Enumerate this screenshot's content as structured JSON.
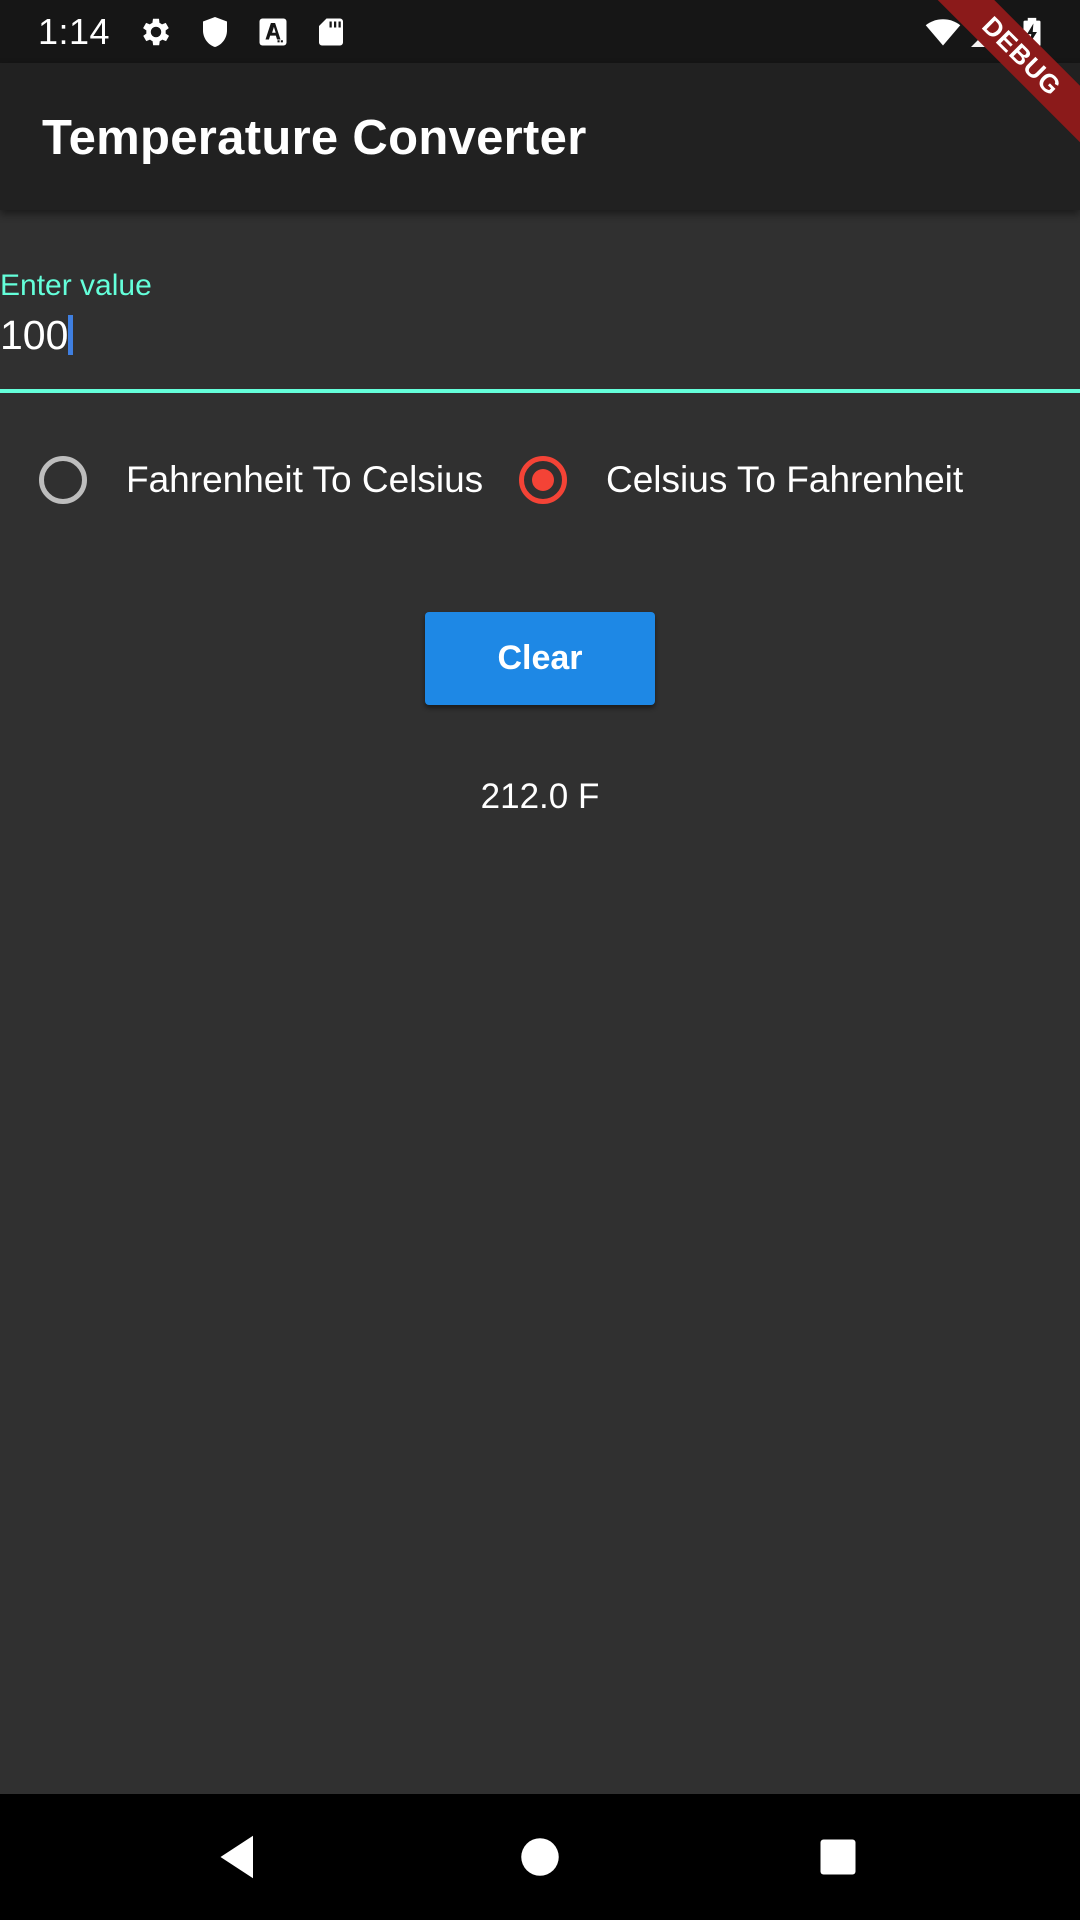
{
  "status_bar": {
    "time": "1:14",
    "left_icons": [
      "settings-icon",
      "shield-icon",
      "text-a-icon",
      "sd-card-icon"
    ],
    "right_icons": [
      "wifi-icon",
      "cell-signal-icon",
      "battery-charging-icon"
    ]
  },
  "debug_banner": {
    "label": "DEBUG",
    "color": "#8b1a1a"
  },
  "app_bar": {
    "title": "Temperature Converter"
  },
  "input": {
    "label": "Enter value",
    "value": "100",
    "accent_color": "#64ffda"
  },
  "conversion_options": [
    {
      "label": "Fahrenheit To Celsius",
      "selected": false
    },
    {
      "label": "Celsius To Fahrenheit",
      "selected": true
    }
  ],
  "clear_button": {
    "label": "Clear",
    "color": "#1e88e5"
  },
  "result": {
    "text": "212.0 F"
  },
  "nav_bar": {
    "buttons": [
      "back-icon",
      "home-icon",
      "recents-icon"
    ]
  },
  "colors": {
    "background": "#303030",
    "app_bar": "#212121",
    "radio_selected": "#f44336",
    "radio_unselected": "#bdbdbd"
  }
}
